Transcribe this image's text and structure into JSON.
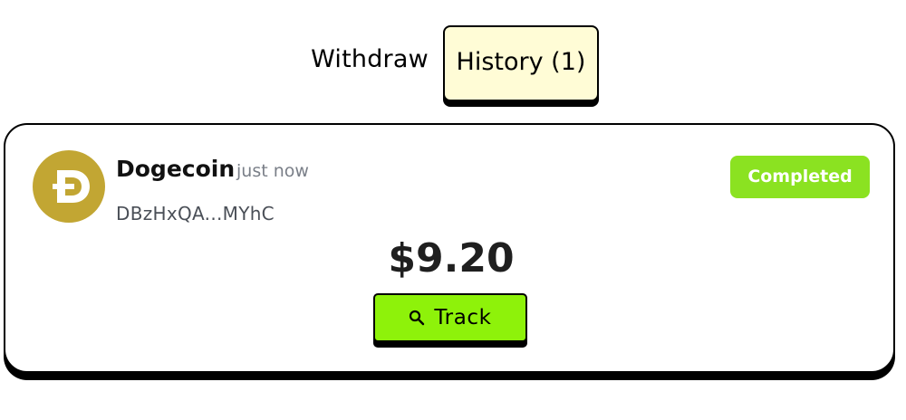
{
  "tabs": [
    {
      "label": "Withdraw",
      "active": false
    },
    {
      "label": "History (1)",
      "active": true
    }
  ],
  "transaction": {
    "coin_name": "Dogecoin",
    "coin_icon": "dogecoin-icon",
    "time": "just now",
    "address": "DBzHxQA...MYhC",
    "status": "Completed",
    "amount": "$9.20",
    "track_label": "Track",
    "track_icon": "search-icon"
  },
  "colors": {
    "history_tab_bg": "#fffcd6",
    "status_badge": "#8be221",
    "track_button": "#8ef20a",
    "dogecoin_gold": "#c2a633"
  }
}
